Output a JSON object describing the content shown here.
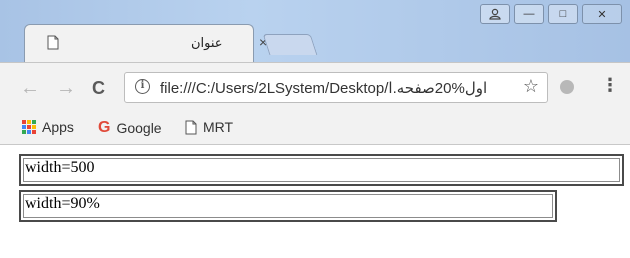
{
  "browser": {
    "tab": {
      "title": "عنوان",
      "close_glyph": "×"
    },
    "window_controls": {
      "minimize": "—",
      "maximize": "□",
      "close": "✕"
    },
    "toolbar": {
      "back_glyph": "←",
      "forward_glyph": "→",
      "reload_glyph": "C",
      "url": "file:///C:/Users/2LSystem/Desktop/اول%20صفحه.ا",
      "info_glyph": "i",
      "star_glyph": "☆",
      "menu_glyph": "⋮"
    },
    "bookmarks": [
      {
        "label": "Apps",
        "icon": "apps-grid-icon"
      },
      {
        "label": "Google",
        "icon": "google-icon"
      },
      {
        "label": "MRT",
        "icon": "page-icon"
      }
    ]
  },
  "page": {
    "box1_text": "width=500",
    "box2_text": "width=90%"
  },
  "colors": {
    "titlebar": "#a9c4e6",
    "toolbar": "#f2f2f2",
    "border": "#4a4a4a"
  }
}
